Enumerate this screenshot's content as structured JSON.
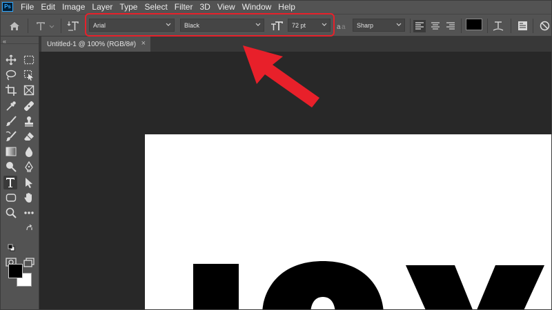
{
  "app": {
    "logo": "Ps"
  },
  "menu": [
    "File",
    "Edit",
    "Image",
    "Layer",
    "Type",
    "Select",
    "Filter",
    "3D",
    "View",
    "Window",
    "Help"
  ],
  "options_bar": {
    "font_family": "Arial",
    "font_style": "Black",
    "font_size": "72 pt",
    "anti_alias": "Sharp",
    "text_color": "#000000"
  },
  "document_tab": {
    "title": "Untitled-1 @ 100% (RGB/8#)",
    "close_glyph": "×"
  },
  "toolbar": {
    "collapse": "«",
    "tools": [
      "move-tool",
      "marquee-tool",
      "lasso-tool",
      "object-selection-tool",
      "crop-tool",
      "frame-tool",
      "eyedropper-tool",
      "healing-brush-tool",
      "brush-tool",
      "clone-stamp-tool",
      "history-brush-tool",
      "eraser-tool",
      "gradient-tool",
      "blur-tool",
      "dodge-tool",
      "pen-tool",
      "type-tool",
      "path-selection-tool",
      "rectangle-tool",
      "hand-tool",
      "zoom-tool",
      "more-tools",
      "quick-mask",
      "screen-mode"
    ],
    "active_tool": "type-tool",
    "foreground_color": "#000000",
    "background_color": "#ffffff"
  },
  "colors": {
    "highlight": "#e8202a",
    "chrome": "#535353",
    "workspace": "#282828"
  }
}
